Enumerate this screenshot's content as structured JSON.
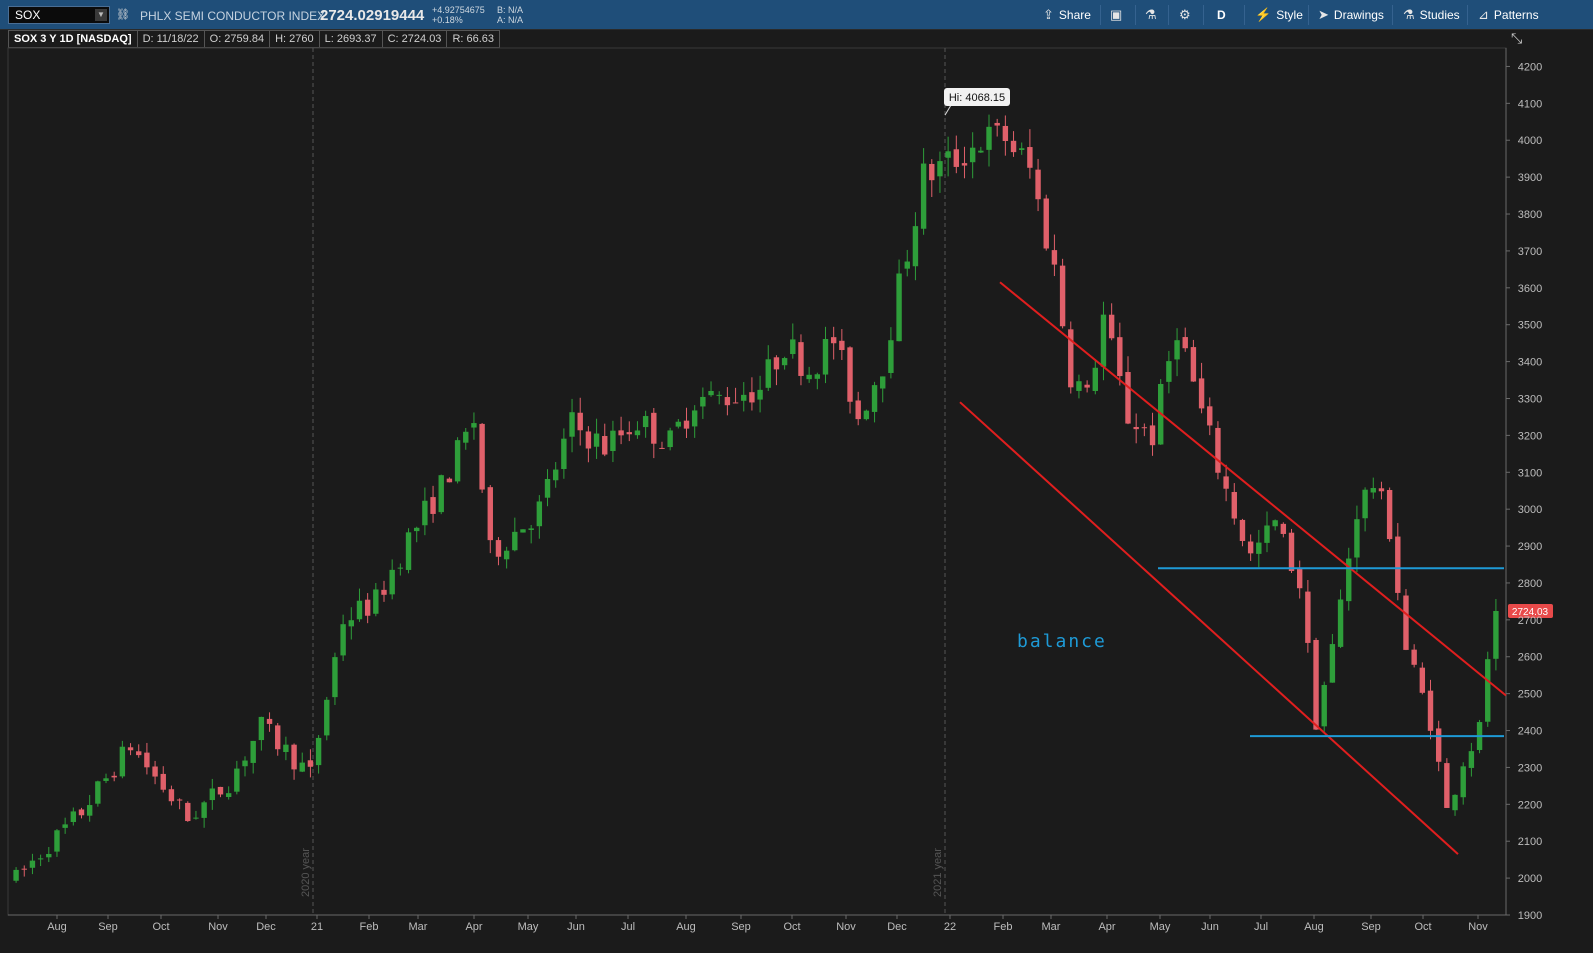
{
  "toolbar": {
    "symbol": "SOX",
    "description": "PHLX SEMI CONDUCTOR INDEX",
    "last_price": "2724.02919444",
    "change": "+4.92754675",
    "change_pct": "+0.18%",
    "bid": "B: N/A",
    "ask": "A: N/A",
    "share": "Share",
    "period": "D",
    "style": "Style",
    "drawings": "Drawings",
    "studies": "Studies",
    "patterns": "Patterns"
  },
  "info": {
    "title": "SOX 3 Y 1D [NASDAQ]",
    "date": "D: 11/18/22",
    "open": "O: 2759.84",
    "high": "H: 2760",
    "low": "L: 2693.37",
    "close": "C: 2724.03",
    "range": "R: 66.63"
  },
  "chart_data": {
    "type": "candlestick",
    "title": "SOX 3 Y 1D [NASDAQ]",
    "ylim": [
      1900,
      4250
    ],
    "y_ticks": [
      1900,
      2000,
      2100,
      2200,
      2300,
      2400,
      2500,
      2600,
      2700,
      2800,
      2900,
      3000,
      3100,
      3200,
      3300,
      3400,
      3500,
      3600,
      3700,
      3800,
      3900,
      4000,
      4100,
      4200
    ],
    "x_ticks": [
      "Aug",
      "Sep",
      "Oct",
      "Nov",
      "Dec",
      "21",
      "Feb",
      "Mar",
      "Apr",
      "May",
      "Jun",
      "Jul",
      "Aug",
      "Sep",
      "Oct",
      "Nov",
      "Dec",
      "22",
      "Feb",
      "Mar",
      "Apr",
      "May",
      "Jun",
      "Jul",
      "Aug",
      "Sep",
      "Oct",
      "Nov"
    ],
    "year_markers": [
      "2020 year",
      "2021 year"
    ],
    "grid": false,
    "colors": {
      "up": "#2e9e3a",
      "down": "#e0606a",
      "background": "#1b1b1b",
      "trend": "#e01e1e",
      "level": "#1e9ad6",
      "last_badge": "#e84a4a"
    },
    "trend_anchors": [
      [
        0,
        2000
      ],
      [
        8,
        2180
      ],
      [
        14,
        2360
      ],
      [
        21,
        2160
      ],
      [
        26,
        2260
      ],
      [
        30,
        2410
      ],
      [
        36,
        2280
      ],
      [
        40,
        2700
      ],
      [
        44,
        2750
      ],
      [
        48,
        2920
      ],
      [
        52,
        3060
      ],
      [
        56,
        3240
      ],
      [
        58,
        2880
      ],
      [
        64,
        3000
      ],
      [
        68,
        3230
      ],
      [
        72,
        3170
      ],
      [
        76,
        3240
      ],
      [
        80,
        3180
      ],
      [
        83,
        3300
      ],
      [
        86,
        3300
      ],
      [
        91,
        3330
      ],
      [
        94,
        3450
      ],
      [
        97,
        3380
      ],
      [
        100,
        3460
      ],
      [
        103,
        3250
      ],
      [
        106,
        3400
      ],
      [
        108,
        3600
      ],
      [
        111,
        3900
      ],
      [
        115,
        3950
      ],
      [
        118,
        4000
      ],
      [
        121,
        4010
      ],
      [
        124,
        3920
      ],
      [
        127,
        3650
      ],
      [
        129,
        3370
      ],
      [
        131,
        3300
      ],
      [
        133,
        3520
      ],
      [
        136,
        3250
      ],
      [
        139,
        3200
      ],
      [
        142,
        3500
      ],
      [
        145,
        3260
      ],
      [
        148,
        3050
      ],
      [
        151,
        2870
      ],
      [
        154,
        2960
      ],
      [
        157,
        2800
      ],
      [
        159,
        2430
      ],
      [
        161,
        2620
      ],
      [
        164,
        3000
      ],
      [
        166,
        3070
      ],
      [
        168,
        2950
      ],
      [
        170,
        2620
      ],
      [
        173,
        2430
      ],
      [
        175,
        2180
      ],
      [
        177,
        2320
      ],
      [
        179,
        2400
      ],
      [
        181,
        2800
      ],
      [
        182,
        2724
      ]
    ],
    "candle_count": 182,
    "annotations": {
      "high_label": "Hi: 4068.15",
      "last_label": "2724.03",
      "text": "balance"
    },
    "trendlines": [
      {
        "from": [
          "Jan 2022",
          3615
        ],
        "to": [
          "Nov 2022",
          2495
        ]
      },
      {
        "from": [
          "Jan 2022",
          3290
        ],
        "to": [
          "Oct 2022",
          2065
        ]
      }
    ],
    "levels": [
      2840,
      2385
    ]
  }
}
